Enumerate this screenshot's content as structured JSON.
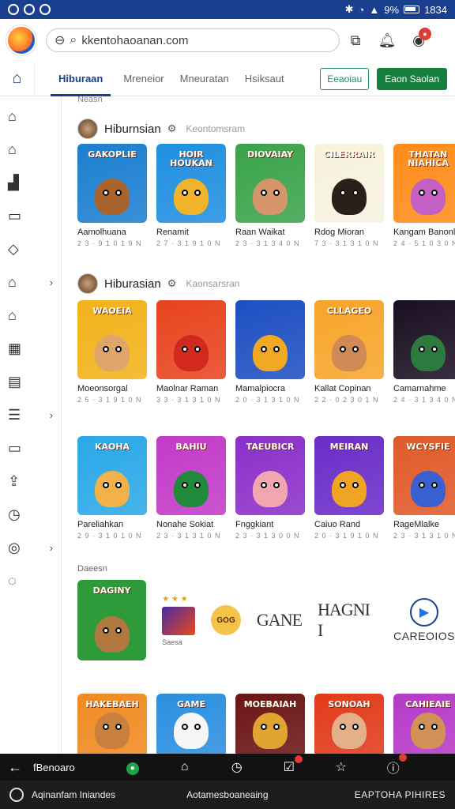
{
  "status_bar": {
    "signal": "9%",
    "time": "1834"
  },
  "browser": {
    "url": "kkentohaoanan.com"
  },
  "tabs": [
    {
      "label": "Hiburaan",
      "active": true
    },
    {
      "label": "Mreneior",
      "active": false
    },
    {
      "label": "Mneuratan",
      "active": false
    },
    {
      "label": "Hsiksaut",
      "active": false
    }
  ],
  "actions": {
    "outline_label": "Eeaoiau",
    "primary_label": "Eaon Saolan"
  },
  "sidebar_icons": [
    "home-icon",
    "home-outline-icon",
    "building-icon",
    "folder-icon",
    "tag-icon",
    "inbox-icon",
    "house-icon",
    "grid-icon",
    "document-icon",
    "list-icon",
    "calendar-icon",
    "upload-icon",
    "clock-icon",
    "chat-icon",
    "check-circle-icon"
  ],
  "main": {
    "top_label": "Neasn",
    "sections": [
      {
        "title": "Hiburnsian",
        "subtitle": "Keontomsram",
        "cards": [
          {
            "banner": "GAKOPLIE",
            "name": "Aamolhuana",
            "meta": "2 3 · 9 1 0 1 9 N",
            "bg": "#1b7fd0",
            "char": "#a7642c"
          },
          {
            "banner": "HOIR HOUKAN",
            "name": "Renamit",
            "meta": "2 7 · 3 1 9 1 0 N",
            "bg": "#1f8fe0",
            "char": "#f2b32c"
          },
          {
            "banner": "DIOVAIAY",
            "name": "Raan Waikat",
            "meta": "2 3 · 3 1 3 4 0 N",
            "bg": "#3aa34a",
            "char": "#d6956a"
          },
          {
            "banner": "CILERRAIR",
            "name": "Rdog Mioran",
            "meta": "7 3 · 3 1 3 1 0 N",
            "bg": "#f6f2dd",
            "char": "#2b1f1a"
          },
          {
            "banner": "THATAN NIAHICA",
            "name": "Kangam Banonl",
            "meta": "2 4 · 5 1 0 3 0 N",
            "bg": "#ff8c1a",
            "char": "#c45fc4"
          }
        ]
      },
      {
        "title": "Hiburasian",
        "subtitle": "Kaonsarsran",
        "cards": [
          {
            "banner": "WAOEIA",
            "name": "Moeonsorgal",
            "meta": "2 5 · 3 1 9 1 0 N",
            "bg": "#f2b21a",
            "char": "#e0a56a"
          },
          {
            "banner": "",
            "name": "Maolnar Raman",
            "meta": "3 3 · 3 1 3 1 0 N",
            "bg": "#e8431e",
            "char": "#d3281e"
          },
          {
            "banner": "",
            "name": "Mamalpiocra",
            "meta": "2 0 · 3 1 3 1 0 N",
            "bg": "#1d4fc2",
            "char": "#f2a922"
          },
          {
            "banner": "CLLAGEO",
            "name": "Kallat Copinan",
            "meta": "2 2 · 0 2 3 0 1 N",
            "bg": "#f7a52a",
            "char": "#cf8a56"
          },
          {
            "banner": "",
            "name": "Camarnahme",
            "meta": "2 4 · 3 1 3 4 0 N",
            "bg": "#1a0f22",
            "char": "#2c7a3d"
          }
        ]
      },
      {
        "title": "",
        "subtitle": "",
        "cards": [
          {
            "banner": "KAOHA",
            "name": "Pareliahkan",
            "meta": "2 9 · 3 1 0 1 0 N",
            "bg": "#2aa8e8",
            "char": "#f2b14a"
          },
          {
            "banner": "BAHIU",
            "name": "Nonahe Sokiat",
            "meta": "2 3 · 3 1 3 1 0 N",
            "bg": "#c23ac8",
            "char": "#1f8a3a"
          },
          {
            "banner": "TAEUBICR",
            "name": "Fnggkiant",
            "meta": "2 3 · 3 1 3 0 0 N",
            "bg": "#8b2fc9",
            "char": "#f2a6b0"
          },
          {
            "banner": "MEIRAN",
            "name": "Caiuo Rand",
            "meta": "2 0 · 3 1 9 1 0 N",
            "bg": "#6a2cc8",
            "char": "#f0a424"
          },
          {
            "banner": "WCYSFIE",
            "name": "RageMlalke",
            "meta": "2 3 · 3 1 3 1 0 N",
            "bg": "#e05a2a",
            "char": "#3a5fd0"
          }
        ]
      }
    ],
    "promo_label": "Daeesn",
    "promo": {
      "game_banner": "DAGINY",
      "mini_label": "Saesa",
      "badge": "GOG",
      "logo1": "GANE",
      "logo2": "HAGNI I",
      "brand": "CAREOIOS"
    },
    "bottom_row": [
      {
        "banner": "HAKEBAEH",
        "bg": "#f08a22",
        "char": "#c8803e"
      },
      {
        "banner": "GAME",
        "bg": "#2a8fe0",
        "char": "#f6f6f6"
      },
      {
        "banner": "MOEBAIAH",
        "bg": "#6b1414",
        "char": "#e2a431"
      },
      {
        "banner": "SONOAH",
        "bg": "#e23a1a",
        "char": "#e4b08a"
      },
      {
        "banner": "CAHIEAIE",
        "bg": "#b63ac8",
        "char": "#d19157"
      }
    ]
  },
  "navbar": {
    "label": "fBenoaro"
  },
  "footer": {
    "left": "Aqinanfam Iniandes",
    "middle": "Aotamesboaneaing",
    "right": "EAPTOHA PIHIRES"
  }
}
